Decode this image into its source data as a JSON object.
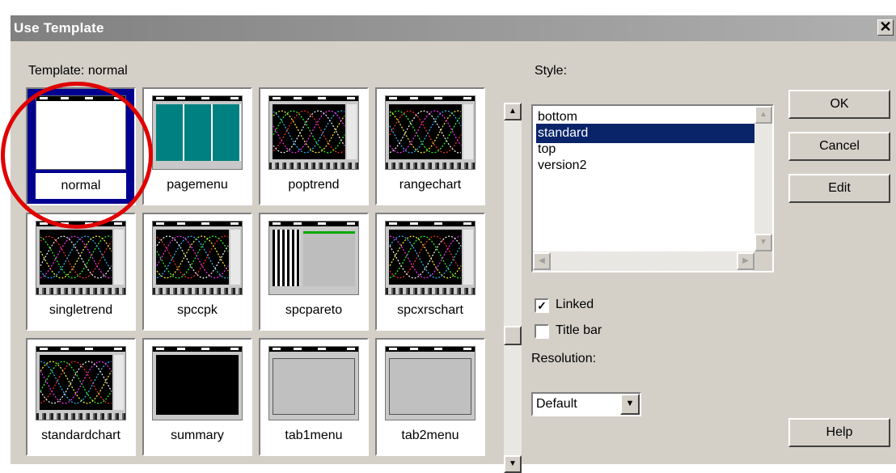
{
  "window": {
    "title": "Use Template",
    "close_label": "✕"
  },
  "template_label": "Template:  normal",
  "templates": [
    {
      "label": "normal",
      "selected": true,
      "thumb": "blank"
    },
    {
      "label": "pagemenu",
      "thumb": "teal"
    },
    {
      "label": "poptrend",
      "thumb": "chart"
    },
    {
      "label": "rangechart",
      "thumb": "chart"
    },
    {
      "label": "singletrend",
      "thumb": "chart"
    },
    {
      "label": "spccpk",
      "thumb": "chart"
    },
    {
      "label": "spcpareto",
      "thumb": "pareto"
    },
    {
      "label": "spcxrschart",
      "thumb": "chart"
    },
    {
      "label": "standardchart",
      "thumb": "chart"
    },
    {
      "label": "summary",
      "thumb": "black"
    },
    {
      "label": "tab1menu",
      "thumb": "gray"
    },
    {
      "label": "tab2menu",
      "thumb": "gray"
    }
  ],
  "style": {
    "label": "Style:",
    "items": [
      "bottom",
      "standard",
      "top",
      "version2"
    ],
    "selected": "standard"
  },
  "buttons": {
    "ok": "OK",
    "cancel": "Cancel",
    "edit": "Edit",
    "help": "Help"
  },
  "options": {
    "linked_label": "Linked",
    "linked_checked": true,
    "titlebar_label": "Title bar",
    "titlebar_checked": false
  },
  "resolution": {
    "label": "Resolution:",
    "value": "Default"
  },
  "colors": {
    "selection": "#0a246a",
    "highlight_ring": "#e00000",
    "tile_selected": "#000090",
    "teal": "#008080"
  }
}
